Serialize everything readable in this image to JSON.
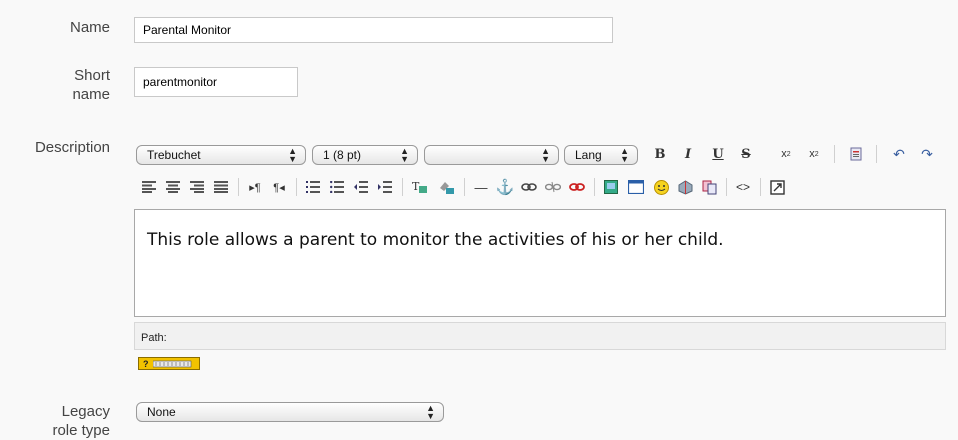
{
  "fields": {
    "name": {
      "label": "Name",
      "value": "Parental Monitor"
    },
    "shortname": {
      "label_line1": "Short",
      "label_line2": "name",
      "value": "parentmonitor"
    },
    "description": {
      "label": "Description"
    },
    "legacy": {
      "label_line1": "Legacy",
      "label_line2": "role type",
      "value": "None"
    }
  },
  "toolbar": {
    "font_family": "Trebuchet",
    "font_size": "1 (8 pt)",
    "format": "",
    "lang": "Lang",
    "bold": "B",
    "italic": "I",
    "underline": "U",
    "strike": "S",
    "subscript": "x",
    "superscript": "x"
  },
  "editor": {
    "content": "This role allows a parent to monitor the activities of his or her child.",
    "path_label": "Path:"
  },
  "icons": [
    "font-family-select",
    "font-size-select",
    "format-select",
    "lang-select",
    "bold-icon",
    "italic-icon",
    "underline-icon",
    "strikethrough-icon",
    "subscript-icon",
    "superscript-icon",
    "paste-word-icon",
    "undo-icon",
    "redo-icon",
    "align-left-icon",
    "align-center-icon",
    "align-right-icon",
    "justify-icon",
    "ltr-icon",
    "rtl-icon",
    "ordered-list-icon",
    "unordered-list-icon",
    "outdent-icon",
    "indent-icon",
    "text-color-icon",
    "background-color-icon",
    "horizontal-rule-icon",
    "anchor-icon",
    "link-icon",
    "unlink-icon",
    "nolink-icon",
    "image-icon",
    "table-icon",
    "smiley-icon",
    "spellcheck-icon",
    "search-replace-icon",
    "html-source-icon",
    "fullscreen-icon",
    "help-icon"
  ],
  "colors": {
    "background": "#f9f9f9",
    "border": "#c9c9c9",
    "help_badge": "#f2c200"
  }
}
